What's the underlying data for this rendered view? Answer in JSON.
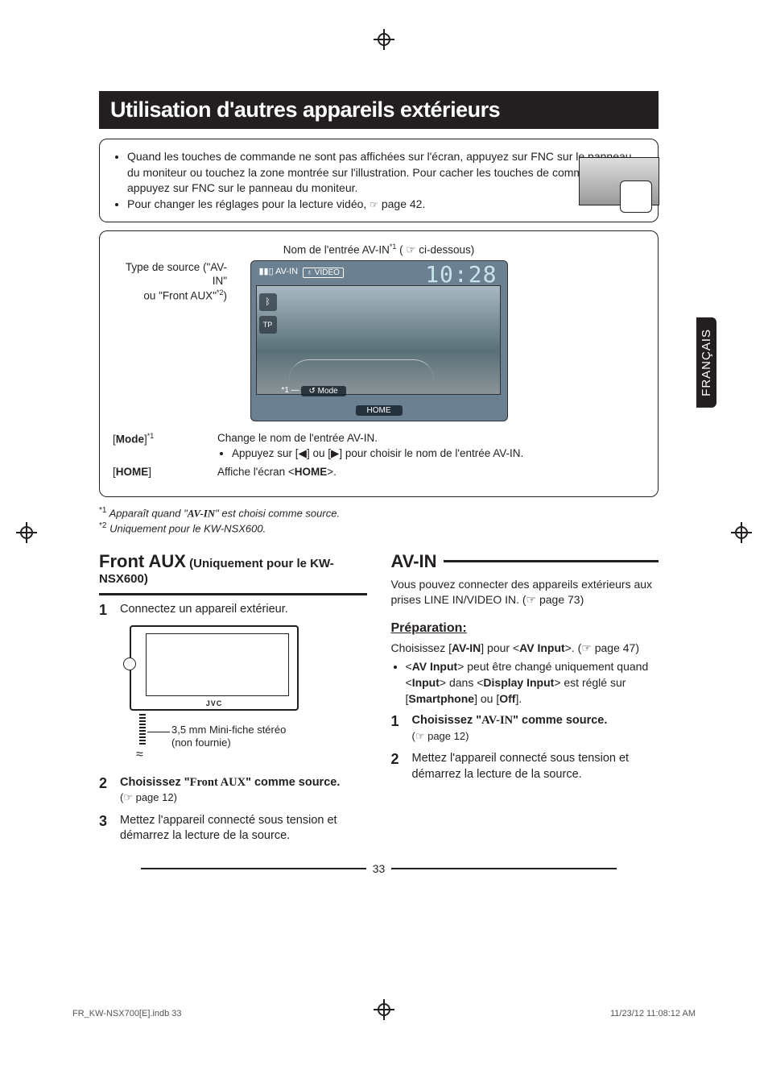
{
  "side_tab": "FRANÇAIS",
  "title": "Utilisation d'autres appareils extérieurs",
  "info_box": {
    "bullet1": "Quand les touches de commande ne sont pas affichées sur l'écran, appuyez sur FNC sur le panneau du moniteur ou touchez la zone montrée sur l'illustration. Pour cacher les touches de commande, appuyez sur FNC sur le panneau du moniteur.",
    "bullet2_pre": "Pour changer les réglages pour la lecture vidéo, ",
    "bullet2_ref": "☞",
    "bullet2_post": " page 42."
  },
  "diagram": {
    "top_label_pre": "Nom de l'entrée AV-IN",
    "top_label_sup": "*1",
    "top_label_post": " ( ☞ ci-dessous)",
    "src_label_l1": "Type de source (\"AV-IN\"",
    "src_label_l2_pre": "ou \"Front AUX\"",
    "src_label_l2_sup": "*2",
    "src_label_l2_post": ")",
    "screen": {
      "av_in": "AV-IN",
      "video": "VIDEO",
      "clock": "10:28",
      "tp": "TP",
      "mode": "Mode",
      "home": "HOME",
      "star1": "*1"
    },
    "rows": [
      {
        "key_pre": "[",
        "key_bold": "Mode",
        "key_post": "]",
        "key_sup": "*1",
        "val_main": "Change le nom de l'entrée AV-IN.",
        "val_bullet_pre": "Appuyez sur [",
        "val_bullet_icon1": "◀",
        "val_bullet_mid": "] ou [",
        "val_bullet_icon2": "▶",
        "val_bullet_post": "] pour choisir le nom de l'entrée AV-IN."
      },
      {
        "key_pre": "[",
        "key_bold": "HOME",
        "key_post": "]",
        "val_pre": "Affiche l'écran <",
        "val_bold": "HOME",
        "val_post": ">."
      }
    ]
  },
  "footnotes": {
    "f1_sup": "*1",
    "f1_pre": "Apparaît quand \"",
    "f1_bold": "AV-IN",
    "f1_post": "\" est choisi comme source.",
    "f2_sup": "*2",
    "f2": "Uniquement pour le KW-NSX600."
  },
  "left_col": {
    "h2": "Front AUX",
    "h2_sub": " (Uniquement pour le KW-NSX600)",
    "step1": "Connectez un appareil extérieur.",
    "plug_l1": "3,5 mm Mini-fiche stéréo",
    "plug_l2": "(non fournie)",
    "step2_pre": "Choisissez \"",
    "step2_bold": "Front AUX",
    "step2_post": "\" comme source.",
    "step2_ref": "(☞ page 12)",
    "step3": "Mettez l'appareil connecté sous tension et démarrez la lecture de la source."
  },
  "right_col": {
    "h2": "AV-IN",
    "intro": "Vous pouvez connecter des appareils extérieurs aux prises LINE IN/VIDEO IN. (☞ page 73)",
    "prep_head": "Préparation:",
    "prep_line_pre": "Choisissez [",
    "prep_line_b1": "AV-IN",
    "prep_line_mid1": "] pour <",
    "prep_line_b2": "AV Input",
    "prep_line_post": ">. (☞ page 47)",
    "prep_bullet_pre": "<",
    "prep_bullet_b1": "AV Input",
    "prep_bullet_mid1": "> peut être changé uniquement quand <",
    "prep_bullet_b2": "Input",
    "prep_bullet_mid2": "> dans <",
    "prep_bullet_b3": "Display Input",
    "prep_bullet_mid3": "> est réglé sur [",
    "prep_bullet_b4": "Smartphone",
    "prep_bullet_mid4": "] ou [",
    "prep_bullet_b5": "Off",
    "prep_bullet_post": "].",
    "step1_pre": "Choisissez \"",
    "step1_bold": "AV-IN",
    "step1_post": "\" comme source.",
    "step1_ref": "(☞ page 12)",
    "step2": "Mettez l'appareil connecté sous tension et démarrez la lecture de la source."
  },
  "page_num": "33",
  "footer_left": "FR_KW-NSX700[E].indb   33",
  "footer_right": "11/23/12   11:08:12 AM"
}
